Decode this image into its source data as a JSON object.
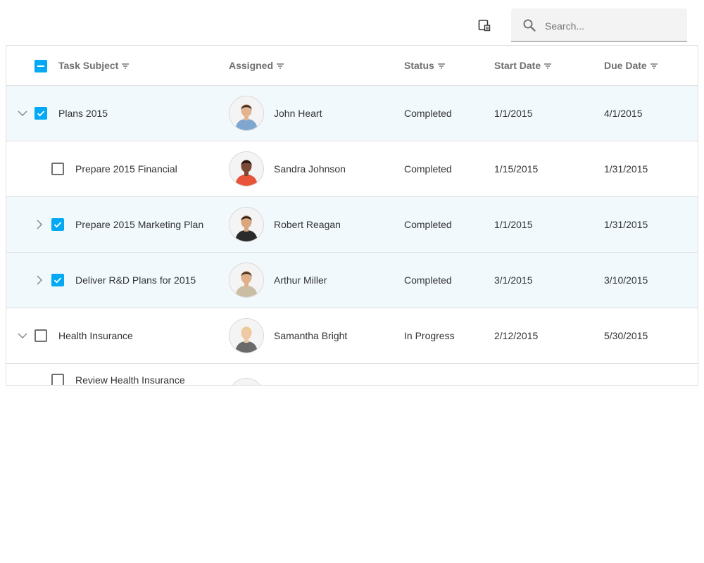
{
  "toolbar": {
    "column_chooser_icon": "column-chooser-icon",
    "search_placeholder": "Search...",
    "search_value": ""
  },
  "columns": [
    {
      "label": "Task Subject"
    },
    {
      "label": "Assigned"
    },
    {
      "label": "Status"
    },
    {
      "label": "Start Date"
    },
    {
      "label": "Due Date"
    }
  ],
  "header_select_state": "indeterminate",
  "rows": [
    {
      "level": 0,
      "expander": "expanded",
      "checked": true,
      "selected": true,
      "subject": "Plans 2015",
      "assigned": "John Heart",
      "status": "Completed",
      "start": "1/1/2015",
      "due": "4/1/2015",
      "avatar": {
        "skin": "#e2b48f",
        "hair": "#3b2a1f",
        "shirt": "#7fa6cf"
      }
    },
    {
      "level": 1,
      "expander": "none",
      "checked": false,
      "selected": false,
      "subject": "Prepare 2015 Financial",
      "assigned": "Sandra Johnson",
      "status": "Completed",
      "start": "1/15/2015",
      "due": "1/31/2015",
      "avatar": {
        "skin": "#7a4a35",
        "hair": "#1e1410",
        "shirt": "#e8543a"
      }
    },
    {
      "level": 1,
      "expander": "collapsed",
      "checked": true,
      "selected": true,
      "subject": "Prepare 2015 Marketing Plan",
      "assigned": "Robert Reagan",
      "status": "Completed",
      "start": "1/1/2015",
      "due": "1/31/2015",
      "avatar": {
        "skin": "#d9a67e",
        "hair": "#2a1c14",
        "shirt": "#2b2b2b"
      }
    },
    {
      "level": 1,
      "expander": "collapsed",
      "checked": true,
      "selected": true,
      "subject": "Deliver R&D Plans for 2015",
      "assigned": "Arthur Miller",
      "status": "Completed",
      "start": "3/1/2015",
      "due": "3/10/2015",
      "avatar": {
        "skin": "#e0b08a",
        "hair": "#4a3424",
        "shirt": "#c9bda4"
      }
    },
    {
      "level": 0,
      "expander": "expanded",
      "checked": false,
      "selected": false,
      "subject": "Health Insurance",
      "assigned": "Samantha Bright",
      "status": "In Progress",
      "start": "2/12/2015",
      "due": "5/30/2015",
      "avatar": {
        "skin": "#efc8a6",
        "hair": "#e6cf8c",
        "shirt": "#6a6a6a"
      }
    },
    {
      "level": 1,
      "expander": "none",
      "checked": false,
      "selected": false,
      "subject": "Review Health Insurance",
      "assigned": "",
      "status": "",
      "start": "",
      "due": "",
      "avatar": {
        "skin": "#efc8a6",
        "hair": "#e6cf8c",
        "shirt": "#6a6a6a"
      }
    }
  ],
  "colors": {
    "accent": "#03a9f4",
    "selected_row": "#f1f9fd",
    "header_text": "#707070",
    "border": "#e0e0e0"
  }
}
